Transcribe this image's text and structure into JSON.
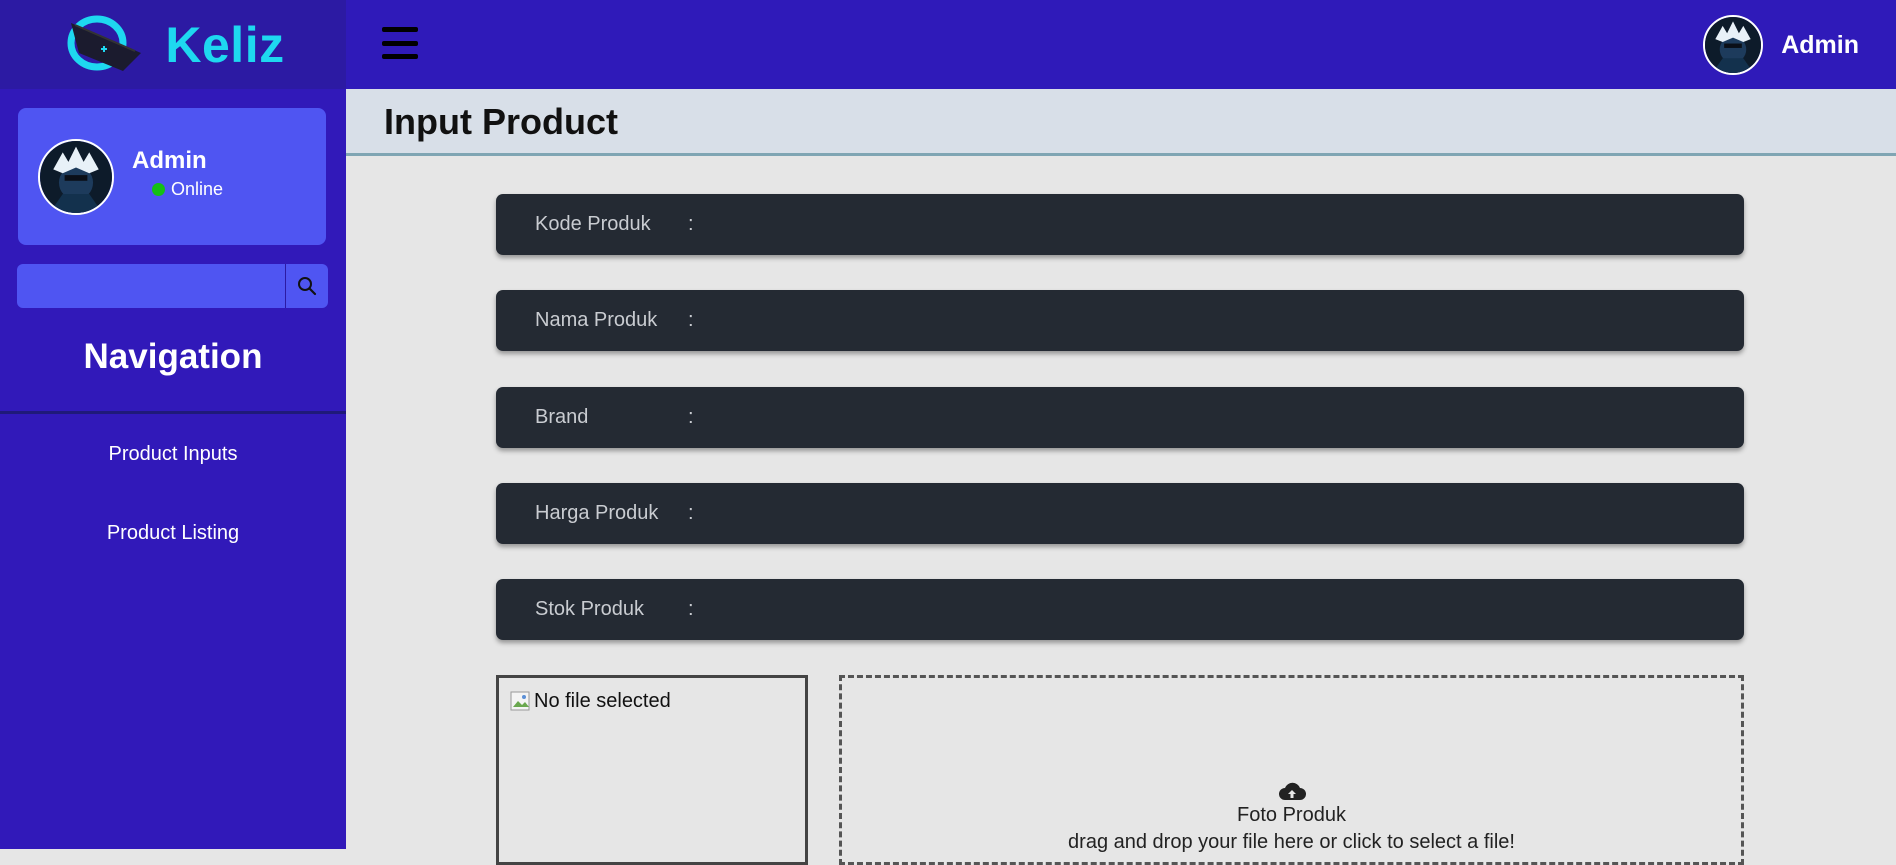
{
  "brand": {
    "name": "Keliz"
  },
  "sidebar": {
    "user": {
      "name": "Admin",
      "status": "Online"
    },
    "search": {
      "placeholder": ""
    },
    "nav_title": "Navigation",
    "items": [
      {
        "label": "Product Inputs"
      },
      {
        "label": "Product Listing"
      }
    ]
  },
  "topbar": {
    "username": "Admin"
  },
  "page": {
    "title": "Input Product"
  },
  "form": {
    "fields": [
      {
        "label": "Kode Produk",
        "colon": ":",
        "value": ""
      },
      {
        "label": "Nama Produk",
        "colon": ":",
        "value": ""
      },
      {
        "label": "Brand",
        "colon": ":",
        "value": ""
      },
      {
        "label": "Harga Produk",
        "colon": ":",
        "value": ""
      },
      {
        "label": "Stok Produk",
        "colon": ":",
        "value": ""
      }
    ],
    "preview_text": "No file selected",
    "dropzone": {
      "title": "Foto Produk",
      "hint": "drag and drop your file here or click to select a file!"
    }
  },
  "colors": {
    "sidebar": "#3119b9",
    "topbar": "#2f1ab9",
    "card": "#4f55f2",
    "field": "#242a33",
    "brand_text": "#1ed8f0",
    "online": "#14c014"
  },
  "icons": [
    "logo-icon",
    "search-icon",
    "menu-icon",
    "upload-cloud-icon",
    "broken-image-icon",
    "avatar"
  ]
}
